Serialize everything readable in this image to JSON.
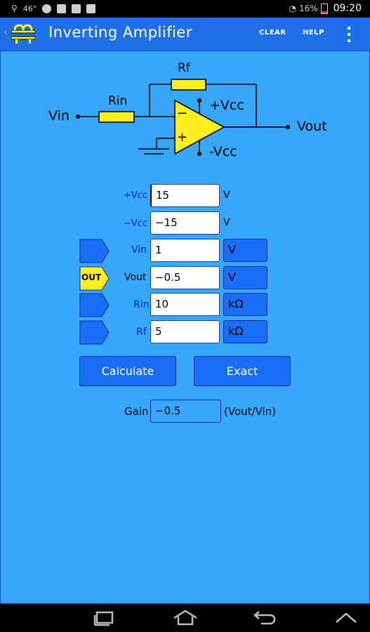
{
  "status_bar": {
    "temperature": "46°",
    "battery": "16%",
    "time": "09:20"
  },
  "action_bar": {
    "title": "Inverting Amplifier",
    "clear_label": "CLEAR",
    "help_label": "HELP",
    "back_glyph": "‹",
    "app_icon": "app-logo-icon",
    "overflow_icon": "overflow-menu-icon"
  },
  "schematic": {
    "vin_label": "Vin",
    "rin_label": "Rin",
    "rf_label": "Rf",
    "vcc_pos_label": "+Vcc",
    "vcc_neg_label": "-Vcc",
    "vout_label": "Vout",
    "minus_sign": "−",
    "plus_sign": "+"
  },
  "form": {
    "vcc_pos": {
      "label": "+Vcc",
      "value": "15",
      "unit": "V"
    },
    "vcc_neg": {
      "label": "−Vcc",
      "value": "−15",
      "unit": "V"
    },
    "vin": {
      "label": "Vin",
      "value": "1",
      "unit": "V"
    },
    "vout": {
      "label": "Vout",
      "value": "−0.5",
      "unit": "V",
      "tag": "OUT"
    },
    "rin": {
      "label": "Rin",
      "value": "10",
      "unit": "kΩ"
    },
    "rf": {
      "label": "Rf",
      "value": "5",
      "unit": "kΩ"
    }
  },
  "buttons": {
    "calculate": "Calculate",
    "exact": "Exact"
  },
  "gain": {
    "label": "Gain",
    "value": "−0.5",
    "unit": "(Vout/Vin)"
  },
  "colors": {
    "action_bar": "#1f6fe6",
    "content_bg": "#36a7fa",
    "button": "#1a6ef5",
    "component_yellow": "#ffee22",
    "label_blue": "#0b24d8"
  }
}
